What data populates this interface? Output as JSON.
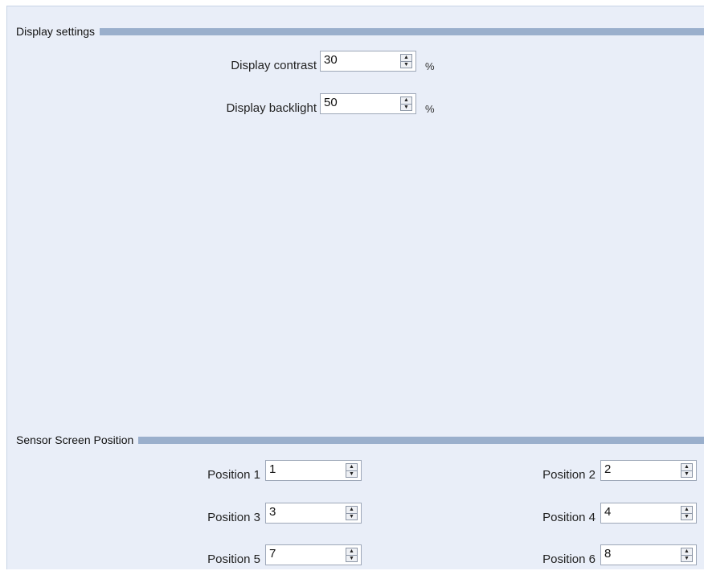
{
  "display_settings": {
    "title": "Display settings",
    "contrast": {
      "label": "Display contrast",
      "value": "30",
      "unit": "%"
    },
    "backlight": {
      "label": "Display backlight",
      "value": "50",
      "unit": "%"
    }
  },
  "sensor_screen_position": {
    "title": "Sensor Screen Position",
    "positions": [
      {
        "label": "Position 1",
        "value": "1"
      },
      {
        "label": "Position 2",
        "value": "2"
      },
      {
        "label": "Position 3",
        "value": "3"
      },
      {
        "label": "Position 4",
        "value": "4"
      },
      {
        "label": "Position 5",
        "value": "7"
      },
      {
        "label": "Position 6",
        "value": "8"
      }
    ]
  },
  "colors": {
    "panel_background": "#e9eef8",
    "section_bar": "#9aafcc"
  },
  "icons": {
    "spinner_up": "arrow-up-icon",
    "spinner_down": "arrow-down-icon"
  }
}
